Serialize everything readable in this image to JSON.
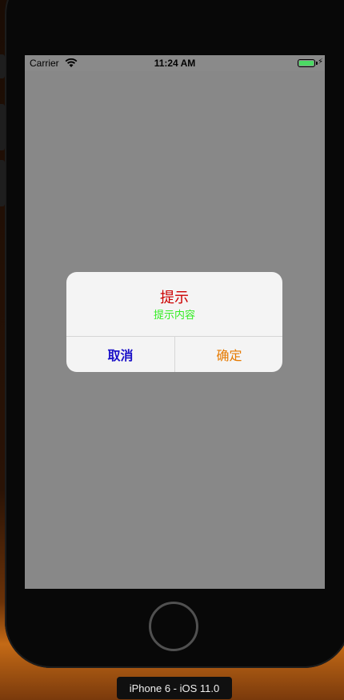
{
  "statusbar": {
    "carrier": "Carrier",
    "time": "11:24 AM",
    "wifi_icon": "wifi-icon",
    "battery_icon": "battery-icon",
    "battery_color": "#4cd964"
  },
  "alert": {
    "title": "提示",
    "message": "提示内容",
    "title_color": "#cc0000",
    "message_color": "#33ee22",
    "buttons": [
      {
        "label": "取消",
        "color": "#1a10c8"
      },
      {
        "label": "确定",
        "color": "#e67a00"
      }
    ]
  },
  "simulator": {
    "device_label": "iPhone 6 - iOS 11.0"
  }
}
